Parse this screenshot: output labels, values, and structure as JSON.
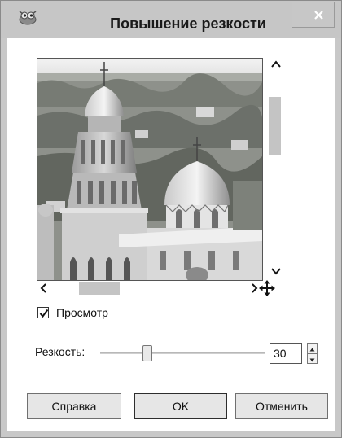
{
  "window": {
    "title": "Повышение резкости",
    "app_icon": "gimp-wilber-icon",
    "close_icon": "close-icon"
  },
  "preview": {
    "image": "monastery-domes-photo",
    "checkbox_label": "Просмотр",
    "checkbox_checked": true
  },
  "scrollbars": {
    "up_icon": "chevron-up-icon",
    "down_icon": "chevron-down-icon",
    "left_icon": "chevron-left-icon",
    "right_icon": "chevron-right-icon",
    "navigate_icon": "move-arrows-icon"
  },
  "sharpness": {
    "label": "Резкость:",
    "value": "30",
    "slider_fraction": 0.3
  },
  "buttons": {
    "help": "Справка",
    "ok": "OK",
    "cancel": "Отменить"
  },
  "colors": {
    "titlebar": "#c6c6c6",
    "frame": "#c8c8c8",
    "client": "#ffffff"
  }
}
